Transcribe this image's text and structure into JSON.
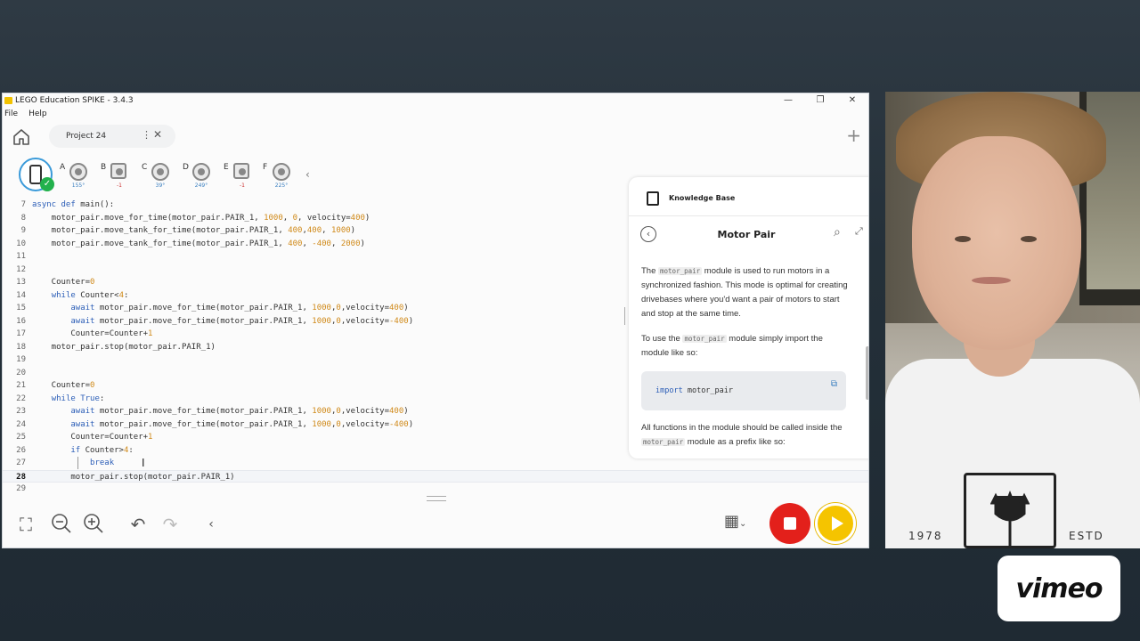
{
  "window": {
    "title": "LEGO Education SPIKE - 3.4.3",
    "menu": [
      "File",
      "Help"
    ]
  },
  "tabs": {
    "project_name": "Project 24"
  },
  "ports": {
    "hub_connected": true,
    "list": [
      {
        "letter": "A",
        "device": "motor",
        "value": "155°"
      },
      {
        "letter": "B",
        "device": "sensor",
        "value": "-1"
      },
      {
        "letter": "C",
        "device": "motor",
        "value": "39°"
      },
      {
        "letter": "D",
        "device": "motor",
        "value": "249°"
      },
      {
        "letter": "E",
        "device": "sensor",
        "value": "-1"
      },
      {
        "letter": "F",
        "device": "motor",
        "value": "225°"
      }
    ]
  },
  "code": {
    "current_line": 28,
    "lines": [
      {
        "n": "7",
        "text": "async def main():"
      },
      {
        "n": "8",
        "text": "    motor_pair.move_for_time(motor_pair.PAIR_1, 1000, 0, velocity=400)"
      },
      {
        "n": "9",
        "text": "    motor_pair.move_tank_for_time(motor_pair.PAIR_1, 400,400, 1000)"
      },
      {
        "n": "10",
        "text": "    motor_pair.move_tank_for_time(motor_pair.PAIR_1, 400, -400, 2000)"
      },
      {
        "n": "11",
        "text": ""
      },
      {
        "n": "12",
        "text": ""
      },
      {
        "n": "13",
        "text": "    Counter=0"
      },
      {
        "n": "14",
        "text": "    while Counter<4:"
      },
      {
        "n": "15",
        "text": "        await motor_pair.move_for_time(motor_pair.PAIR_1, 1000,0,velocity=400)"
      },
      {
        "n": "16",
        "text": "        await motor_pair.move_for_time(motor_pair.PAIR_1, 1000,0,velocity=-400)"
      },
      {
        "n": "17",
        "text": "        Counter=Counter+1"
      },
      {
        "n": "18",
        "text": "    motor_pair.stop(motor_pair.PAIR_1)"
      },
      {
        "n": "19",
        "text": ""
      },
      {
        "n": "20",
        "text": ""
      },
      {
        "n": "21",
        "text": "    Counter=0"
      },
      {
        "n": "22",
        "text": "    while True:"
      },
      {
        "n": "23",
        "text": "        await motor_pair.move_for_time(motor_pair.PAIR_1, 1000,0,velocity=400)"
      },
      {
        "n": "24",
        "text": "        await motor_pair.move_for_time(motor_pair.PAIR_1, 1000,0,velocity=-400)"
      },
      {
        "n": "25",
        "text": "        Counter=Counter+1"
      },
      {
        "n": "26",
        "text": "        if Counter>4:"
      },
      {
        "n": "27",
        "text": "            break"
      },
      {
        "n": "28",
        "text": "        motor_pair.stop(motor_pair.PAIR_1)"
      },
      {
        "n": "29",
        "text": ""
      }
    ]
  },
  "knowledge_base": {
    "title": "Knowledge Base",
    "heading": "Motor Pair",
    "p1_before": "The ",
    "p1_code": "motor_pair",
    "p1_after": " module is used to run motors in a synchronized fashion. This mode is optimal for creating drivebases where you'd want a pair of motors to start and stop at the same time.",
    "p2_before": "To use the ",
    "p2_code": "motor_pair",
    "p2_after": " module simply import the module like so:",
    "code_kw": "import",
    "code_rest": " motor_pair",
    "p3_before": "All functions in the module should be called inside the ",
    "p3_code": "motor_pair",
    "p3_after": " module as a prefix like so:"
  },
  "overlay": {
    "vimeo_label": "vimeo",
    "shirt_left": "1978",
    "shirt_right": "ESTD"
  },
  "colors": {
    "stop": "#e3201b",
    "play": "#f5c400",
    "keyword": "#2c5eb7",
    "number": "#d08a1a",
    "hub_ring": "#3a9ad9"
  }
}
